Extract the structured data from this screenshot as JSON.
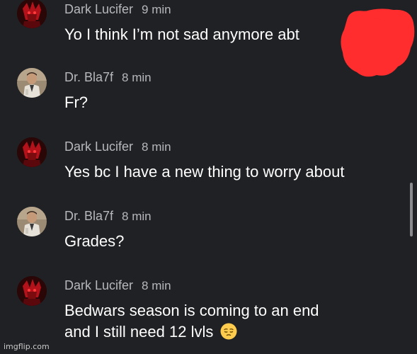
{
  "messages": [
    {
      "author": "Dark Lucifer",
      "time": "9 min",
      "lines": [
        "Yo I think I’m not sad anymore abt"
      ],
      "avatar": "dark-lucifer-avatar"
    },
    {
      "author": "Dr. Bla7f",
      "time": "8 min",
      "lines": [
        "Fr?"
      ],
      "avatar": "dr-bla7f-avatar"
    },
    {
      "author": "Dark Lucifer",
      "time": "8 min",
      "lines": [
        "Yes bc I have a new thing to worry about"
      ],
      "avatar": "dark-lucifer-avatar"
    },
    {
      "author": "Dr. Bla7f",
      "time": "8 min",
      "lines": [
        "Grades?"
      ],
      "avatar": "dr-bla7f-avatar"
    },
    {
      "author": "Dark Lucifer",
      "time": "8 min",
      "lines": [
        "Bedwars season is coming to an end",
        "and I still need 12 lvls"
      ],
      "avatar": "dark-lucifer-avatar",
      "emoji": "pensive-face-icon"
    }
  ],
  "watermark": "imgflip.com",
  "colors": {
    "background": "#202124",
    "meta_text": "#b7b8bb",
    "message_text": "#ffffff",
    "redaction": "#ff2d2d",
    "emoji_yellow": "#ffcc4d"
  }
}
